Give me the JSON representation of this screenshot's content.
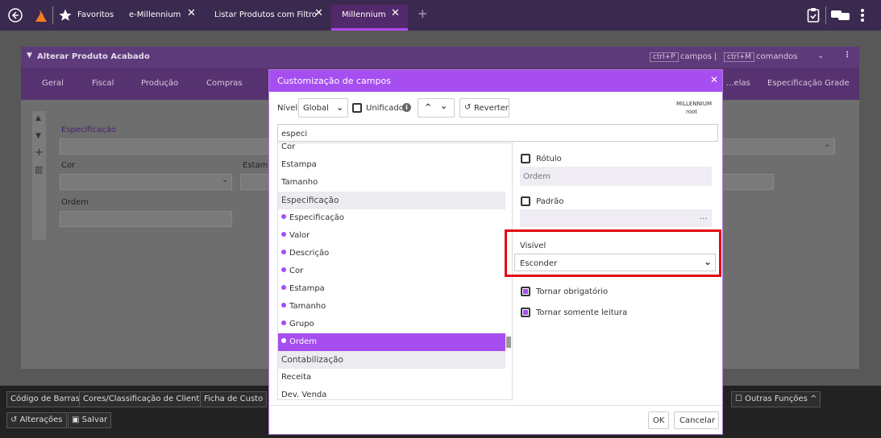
{
  "topbar": {
    "tabs": [
      {
        "label": "Favoritos"
      },
      {
        "label": "e-Millennium"
      },
      {
        "label": "Listar Produtos com Filtro"
      },
      {
        "label": "Millennium"
      }
    ]
  },
  "panel": {
    "title": "Alterar Produto Acabado",
    "shortcuts": {
      "campos_key": "ctrl+P",
      "campos": "campos",
      "comandos_key": "ctrl+M",
      "comandos": "comandos"
    },
    "tabs": [
      "Geral",
      "Fiscal",
      "Produção",
      "Compras",
      "...elas",
      "Especificação Grade"
    ],
    "fields": {
      "especificacao": "Especificação",
      "cor": "Cor",
      "estampa": "Estamp",
      "ordem": "Ordem"
    }
  },
  "bottombar": {
    "buttons": [
      "Código de Barras",
      "Cores/Classificação de Cliente",
      "Ficha de Custo",
      "Outras Funções"
    ],
    "actions": [
      "Alterações",
      "Salvar"
    ]
  },
  "modal": {
    "title": "Customização de campos",
    "toolbar": {
      "nivel_label": "Nível",
      "nivel_value": "Global",
      "unificado_label": "Unificado",
      "reverter_label": "Reverter",
      "user_line1": "MILLENNIUM",
      "user_line2": "root"
    },
    "search_value": "especi",
    "list": [
      {
        "label": "Cor",
        "kind": "plain"
      },
      {
        "label": "Estampa",
        "kind": "plain"
      },
      {
        "label": "Tamanho",
        "kind": "plain"
      },
      {
        "label": "Especificação",
        "kind": "group"
      },
      {
        "label": "Especificação",
        "kind": "dot"
      },
      {
        "label": "Valor",
        "kind": "dot"
      },
      {
        "label": "Descrição",
        "kind": "dot"
      },
      {
        "label": "Cor",
        "kind": "dot"
      },
      {
        "label": "Estampa",
        "kind": "dot"
      },
      {
        "label": "Tamanho",
        "kind": "dot"
      },
      {
        "label": "Grupo",
        "kind": "dot"
      },
      {
        "label": "Ordem",
        "kind": "selected"
      },
      {
        "label": "Contabilização",
        "kind": "group"
      },
      {
        "label": "Receita",
        "kind": "plain"
      },
      {
        "label": "Dev. Venda",
        "kind": "plain"
      }
    ],
    "props": {
      "rotulo_label": "Rótulo",
      "rotulo_value": "Ordem",
      "padrao_label": "Padrão",
      "padrao_btn": "...",
      "visivel_label": "Visível",
      "visivel_value": "Esconder",
      "obrigatorio_label": "Tornar obrigatório",
      "leitura_label": "Tornar somente leitura"
    },
    "footer": {
      "ok": "OK",
      "cancel": "Cancelar"
    },
    "highlight_color": "#e30613",
    "accent_color": "#a64ef0"
  }
}
